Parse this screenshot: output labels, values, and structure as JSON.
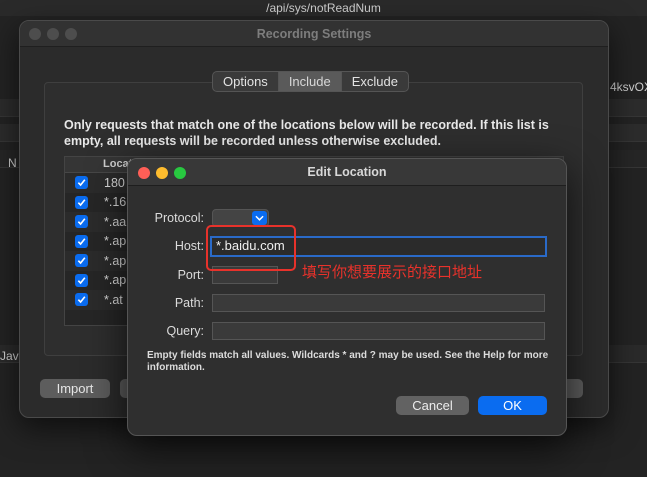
{
  "background": {
    "top_title": "/api/sys/notReadNum",
    "right_fragment": "4ksvOX",
    "left_fragment_n": "N",
    "left_fragment_jav": "Jav"
  },
  "recording_window": {
    "title": "Recording Settings",
    "tabs": [
      {
        "label": "Options",
        "active": false
      },
      {
        "label": "Include",
        "active": true
      },
      {
        "label": "Exclude",
        "active": false
      }
    ],
    "description": "Only requests that match one of the locations below will be recorded. If this list is empty, all requests will be recorded unless otherwise excluded.",
    "table": {
      "header": "Locat",
      "rows": [
        {
          "checked": true,
          "text": "180"
        },
        {
          "checked": true,
          "text": "*.16"
        },
        {
          "checked": true,
          "text": "*.aa"
        },
        {
          "checked": true,
          "text": "*.ap"
        },
        {
          "checked": true,
          "text": "*.ap"
        },
        {
          "checked": true,
          "text": "*.ap"
        },
        {
          "checked": true,
          "text": "*.at"
        }
      ]
    },
    "import_label": "Import"
  },
  "edit_location": {
    "title": "Edit Location",
    "protocol_label": "Protocol:",
    "host_label": "Host:",
    "host_value": "*.baidu.com",
    "port_label": "Port:",
    "path_label": "Path:",
    "query_label": "Query:",
    "note": "Empty fields match all values. Wildcards * and ? may be used. See the Help for more information.",
    "cancel_label": "Cancel",
    "ok_label": "OK"
  },
  "annotation": {
    "text": "填写你想要展示的接口地址",
    "color": "#e8322b"
  }
}
